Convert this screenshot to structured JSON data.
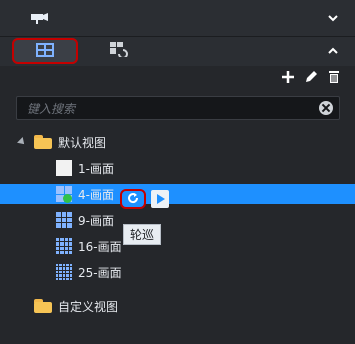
{
  "toolbar": {
    "add_icon": "plus-icon",
    "edit_icon": "pencil-icon",
    "delete_icon": "trash-icon"
  },
  "search": {
    "placeholder": "键入搜索"
  },
  "tree": {
    "default_view": "默认视图",
    "items": [
      {
        "label": "1-画面"
      },
      {
        "label": "4-画面"
      },
      {
        "label": "9-画面"
      },
      {
        "label": "16-画面"
      },
      {
        "label": "25-画面"
      }
    ],
    "custom_view": "自定义视图"
  },
  "tooltip": "轮巡",
  "colors": {
    "selected_row": "#1e90ff",
    "highlight_border": "#c40000"
  }
}
